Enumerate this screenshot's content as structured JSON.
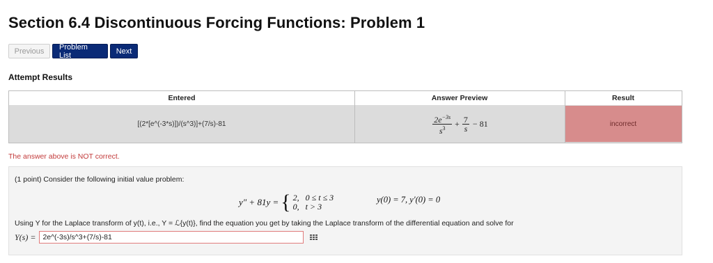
{
  "page": {
    "title": "Section 6.4 Discontinuous Forcing Functions: Problem 1"
  },
  "nav": {
    "previous": "Previous",
    "problem_list": "Problem List",
    "next": "Next"
  },
  "attempt": {
    "heading": "Attempt Results",
    "columns": [
      "Entered",
      "Answer Preview",
      "Result"
    ],
    "entered": "[(2*[e^(-3*s)])/(s^3)]+(7/s)-81",
    "preview": {
      "num1": "2e",
      "exp1": "−3s",
      "den1": "s",
      "den1_exp": "3",
      "plus": "+",
      "num2": "7",
      "den2": "s",
      "tail": "− 81"
    },
    "result": "incorrect",
    "feedback": "The answer above is NOT correct."
  },
  "problem": {
    "intro": "(1 point) Consider the following initial value problem:",
    "lhs": "y″ + 81y =",
    "case1": "2,   0 ≤ t ≤ 3",
    "case2": "0,   t > 3",
    "initial_conditions": "y(0) = 7,  y′(0) = 0",
    "instruction": "Using Y for the Laplace transform of y(t), i.e., Y = ℒ{y(t)}, find the equation you get by taking the Laplace transform of the differential equation and solve for",
    "answer_label": "Y(s) =",
    "answer_value": "2e^(-3s)/s^3+(7/s)-81"
  },
  "colors": {
    "primary_button": "#0a2a76",
    "incorrect_bg": "#d78c8c",
    "error_text": "#c23a3a"
  }
}
